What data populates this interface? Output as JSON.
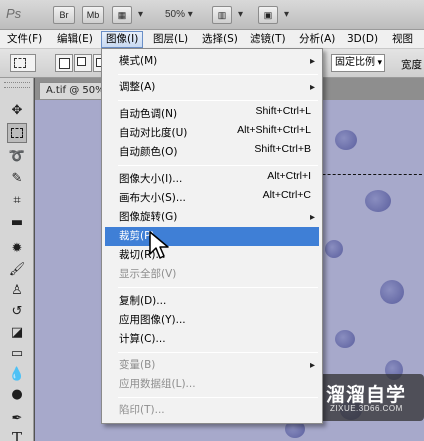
{
  "app": {
    "logo": "Ps",
    "bridge_button": "Br",
    "minibridge_button": "Mb",
    "zoom_level": "50%"
  },
  "menubar": {
    "items": [
      {
        "label": "文件(F)"
      },
      {
        "label": "编辑(E)"
      },
      {
        "label": "图像(I)"
      },
      {
        "label": "图层(L)"
      },
      {
        "label": "选择(S)"
      },
      {
        "label": "滤镜(T)"
      },
      {
        "label": "分析(A)"
      },
      {
        "label": "3D(D)"
      },
      {
        "label": "视图(V)"
      }
    ],
    "active_index": 2
  },
  "optionsbar": {
    "ratio_select": "固定比例",
    "width_label": "宽度"
  },
  "document": {
    "tab_title": "A.tif @ 50%"
  },
  "image_menu": {
    "items": [
      {
        "label": "模式(M)",
        "shortcut": "",
        "submenu": true,
        "disabled": false
      },
      {
        "label": "调整(A)",
        "shortcut": "",
        "submenu": true,
        "disabled": false
      },
      {
        "label": "自动色调(N)",
        "shortcut": "Shift+Ctrl+L",
        "submenu": false,
        "disabled": false
      },
      {
        "label": "自动对比度(U)",
        "shortcut": "Alt+Shift+Ctrl+L",
        "submenu": false,
        "disabled": false
      },
      {
        "label": "自动颜色(O)",
        "shortcut": "Shift+Ctrl+B",
        "submenu": false,
        "disabled": false
      },
      {
        "label": "图像大小(I)...",
        "shortcut": "Alt+Ctrl+I",
        "submenu": false,
        "disabled": false
      },
      {
        "label": "画布大小(S)...",
        "shortcut": "Alt+Ctrl+C",
        "submenu": false,
        "disabled": false
      },
      {
        "label": "图像旋转(G)",
        "shortcut": "",
        "submenu": true,
        "disabled": false
      },
      {
        "label": "裁剪(P)",
        "shortcut": "",
        "submenu": false,
        "disabled": false,
        "highlighted": true
      },
      {
        "label": "裁切(R)...",
        "shortcut": "",
        "submenu": false,
        "disabled": false
      },
      {
        "label": "显示全部(V)",
        "shortcut": "",
        "submenu": false,
        "disabled": true
      },
      {
        "label": "复制(D)...",
        "shortcut": "",
        "submenu": false,
        "disabled": false
      },
      {
        "label": "应用图像(Y)...",
        "shortcut": "",
        "submenu": false,
        "disabled": false
      },
      {
        "label": "计算(C)...",
        "shortcut": "",
        "submenu": false,
        "disabled": false
      },
      {
        "label": "变量(B)",
        "shortcut": "",
        "submenu": true,
        "disabled": true
      },
      {
        "label": "应用数据组(L)...",
        "shortcut": "",
        "submenu": false,
        "disabled": true
      },
      {
        "label": "陷印(T)...",
        "shortcut": "",
        "submenu": false,
        "disabled": true
      }
    ]
  },
  "watermark": {
    "title": "溜溜自学",
    "url": "ZIXUE.3D66.COM"
  },
  "colors": {
    "highlight": "#3f7fd6",
    "menu_bg": "#f2f2f2",
    "canvas": "#a7a9cb"
  }
}
